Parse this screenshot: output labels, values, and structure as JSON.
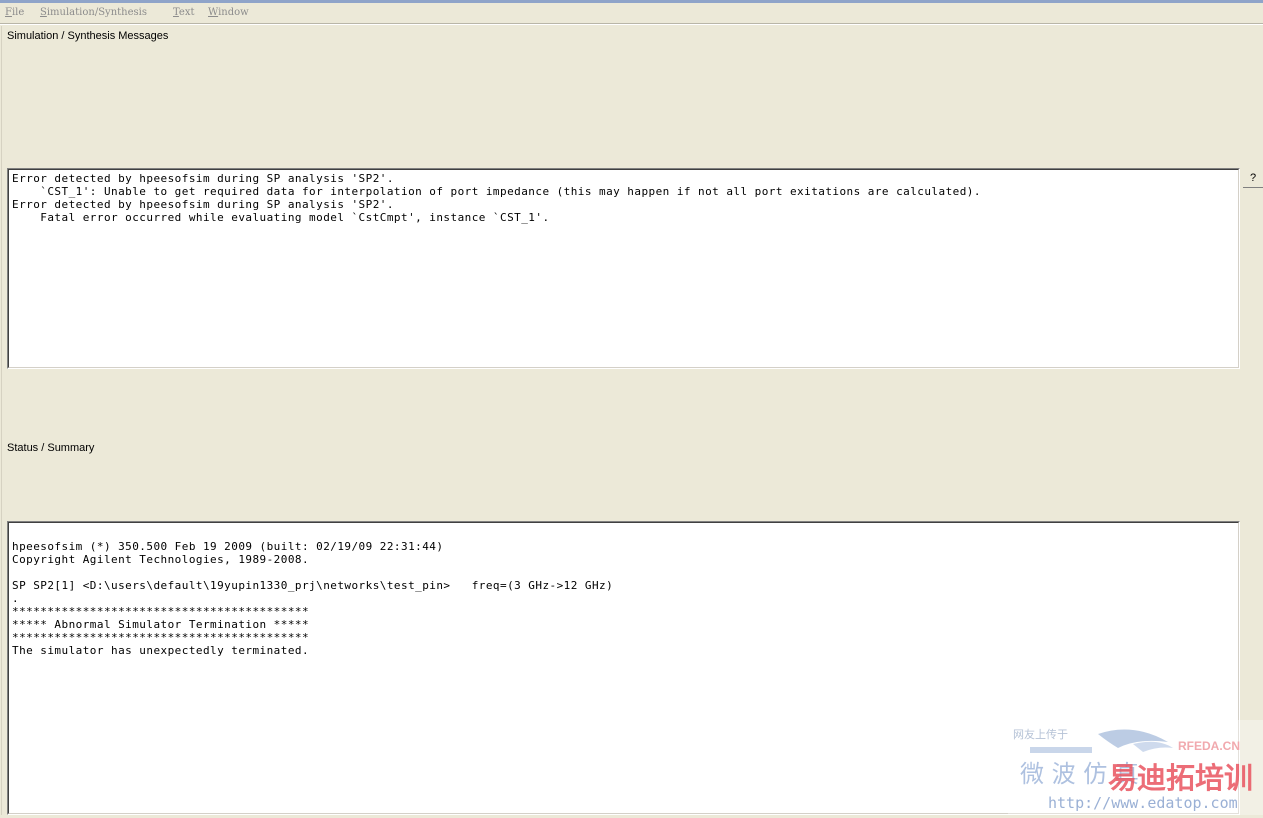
{
  "menu": {
    "items": [
      {
        "label": "File",
        "mnemonic": "F",
        "rest": "ile"
      },
      {
        "label": "Simulation/Synthesis",
        "mnemonic": "S",
        "rest": "imulation/Synthesis"
      },
      {
        "label": "Text",
        "mnemonic": "T",
        "rest": "ext"
      },
      {
        "label": "Window",
        "mnemonic": "W",
        "rest": "indow"
      }
    ]
  },
  "messages": {
    "title": "Simulation / Synthesis Messages",
    "lines": [
      "Error detected by hpeesofsim during SP analysis 'SP2'.",
      "    `CST_1': Unable to get required data for interpolation of port impedance (this may happen if not all port exitations are calculated).",
      "Error detected by hpeesofsim during SP analysis 'SP2'.",
      "    Fatal error occurred while evaluating model `CstCmpt', instance `CST_1'."
    ]
  },
  "status": {
    "title": "Status / Summary",
    "lines": [
      "hpeesofsim (*) 350.500 Feb 19 2009 (built: 02/19/09 22:31:44)",
      "Copyright Agilent Technologies, 1989-2008.",
      "",
      "SP SP2[1] <D:\\users\\default\\19yupin1330_prj\\networks\\test_pin>   freq=(3 GHz->12 GHz)",
      ".",
      "******************************************",
      "***** Abnormal Simulator Termination *****",
      "******************************************",
      "The simulator has unexpectedly terminated."
    ]
  },
  "side": {
    "help_mark": "?"
  },
  "watermark": {
    "line1": "网友上传于",
    "brand": "RFEDA.CN",
    "cn_left": "微 波 仿 真",
    "cn_right": "易迪拓培训",
    "url": "http://www.edatop.com"
  }
}
